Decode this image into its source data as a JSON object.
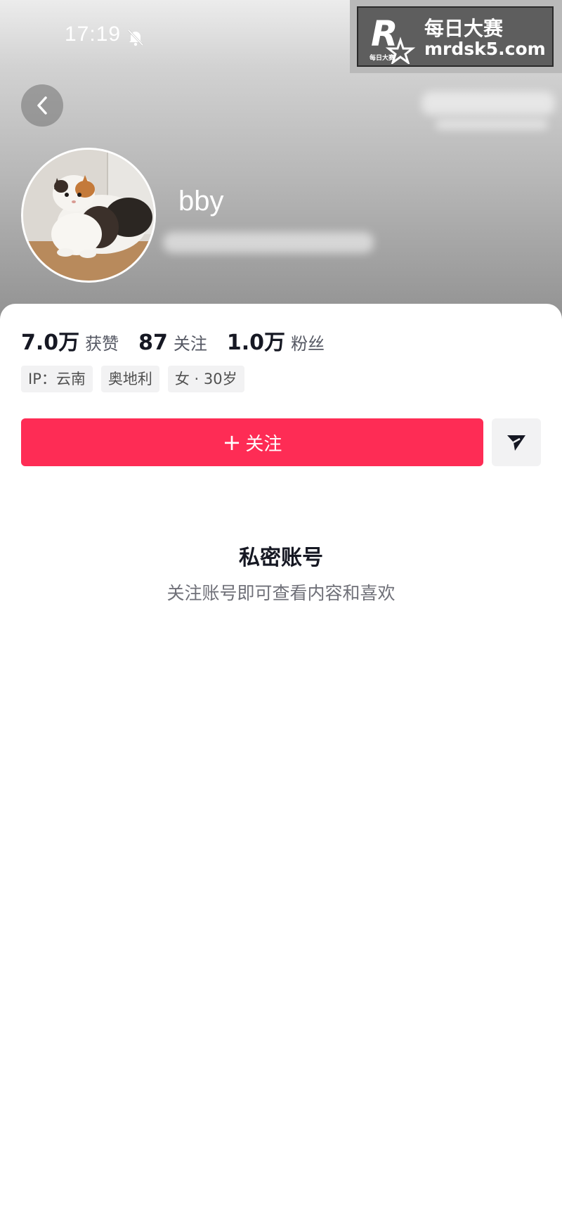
{
  "status_bar": {
    "time": "17:19",
    "mute_icon": "bell-slash-icon"
  },
  "watermark": {
    "logo_text": "R",
    "logo_sub": "每日大赛",
    "title": "每日大赛",
    "url": "mrdsk5.com"
  },
  "header": {
    "back_icon": "chevron-left-icon"
  },
  "profile": {
    "username": "bby"
  },
  "stats": [
    {
      "value": "7.0万",
      "label": "获赞"
    },
    {
      "value": "87",
      "label": "关注"
    },
    {
      "value": "1.0万",
      "label": "粉丝"
    }
  ],
  "tags": [
    "IP：云南",
    "奥地利",
    "女 · 30岁"
  ],
  "actions": {
    "follow_plus": "+",
    "follow_label": "关注",
    "share_icon": "send-icon"
  },
  "private": {
    "title": "私密账号",
    "subtitle": "关注账号即可查看内容和喜欢"
  },
  "colors": {
    "accent": "#fe2c55",
    "text": "#161823",
    "muted": "#6f7078"
  }
}
